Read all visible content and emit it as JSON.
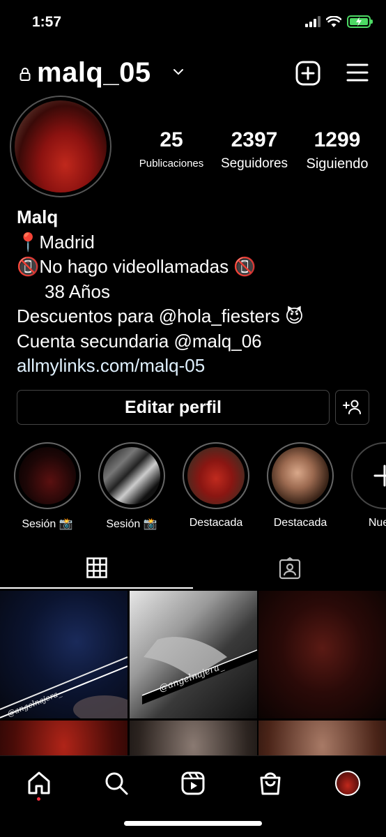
{
  "status_bar": {
    "time": "1:57"
  },
  "header": {
    "username": "malq_05"
  },
  "profile": {
    "stats": [
      {
        "value": "25",
        "label": "Publicaciones"
      },
      {
        "value": "2397",
        "label": "Seguidores"
      },
      {
        "value": "1299",
        "label": "Siguiendo"
      }
    ],
    "bio": {
      "name": "Malq",
      "line1": "📍Madrid",
      "line2": "📵No hago videollamadas 📵",
      "line3": "38 Años",
      "line4": "Descuentos para @hola_fiesters 😈",
      "line5": "Cuenta secundaria @malq_06",
      "link": "allmylinks.com/malq-05"
    },
    "edit_button": "Editar perfil"
  },
  "highlights": [
    {
      "label": "Sesión 📸"
    },
    {
      "label": "Sesión 📸"
    },
    {
      "label": "Destacada"
    },
    {
      "label": "Destacada"
    },
    {
      "label": "Nuevo"
    }
  ],
  "grid": {
    "watermark_1": "@angelnajera_",
    "watermark_2": "@angelnajera_"
  },
  "colors": {
    "background": "#000000",
    "notification_dot": "#ff3040",
    "battery": "#4cd964"
  }
}
